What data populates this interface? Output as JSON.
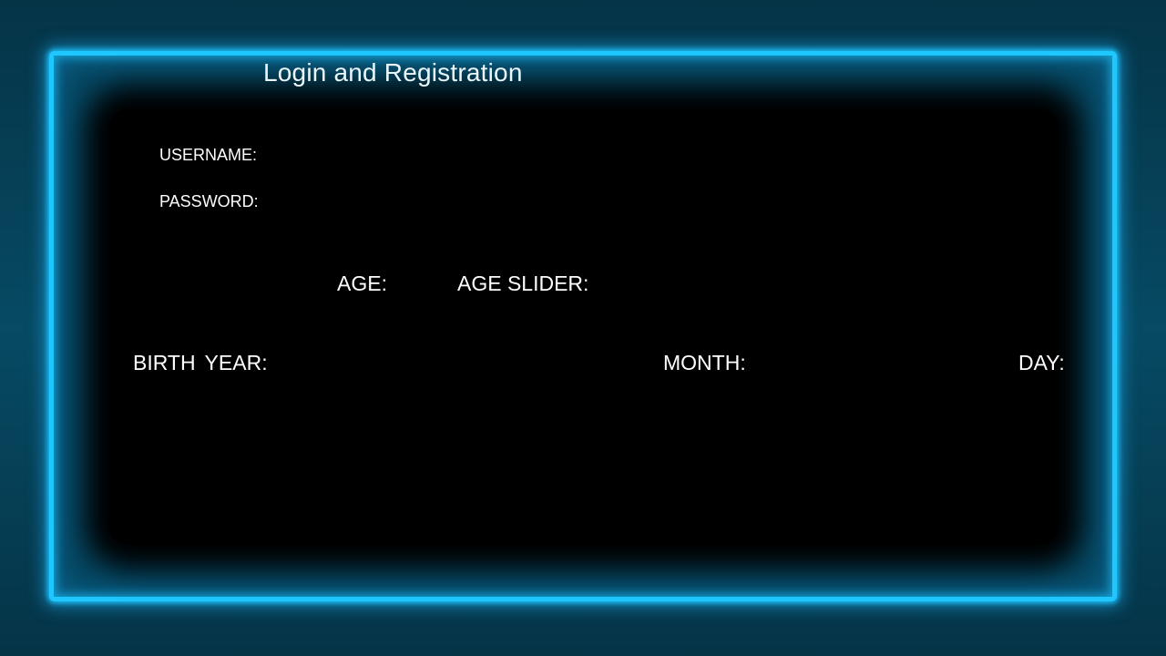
{
  "window": {
    "title": "Login and Registration"
  },
  "form": {
    "username_label": "USERNAME:",
    "password_label": "PASSWORD:",
    "age_label": "AGE:",
    "age_slider_label": "AGE SLIDER:",
    "birth_year_label": "BIRTH YEAR:",
    "month_label": "MONTH:",
    "day_label": "DAY:"
  },
  "colors": {
    "neon_accent": "#1ec8ff",
    "panel_background": "#000000",
    "text": "#ffffff"
  }
}
